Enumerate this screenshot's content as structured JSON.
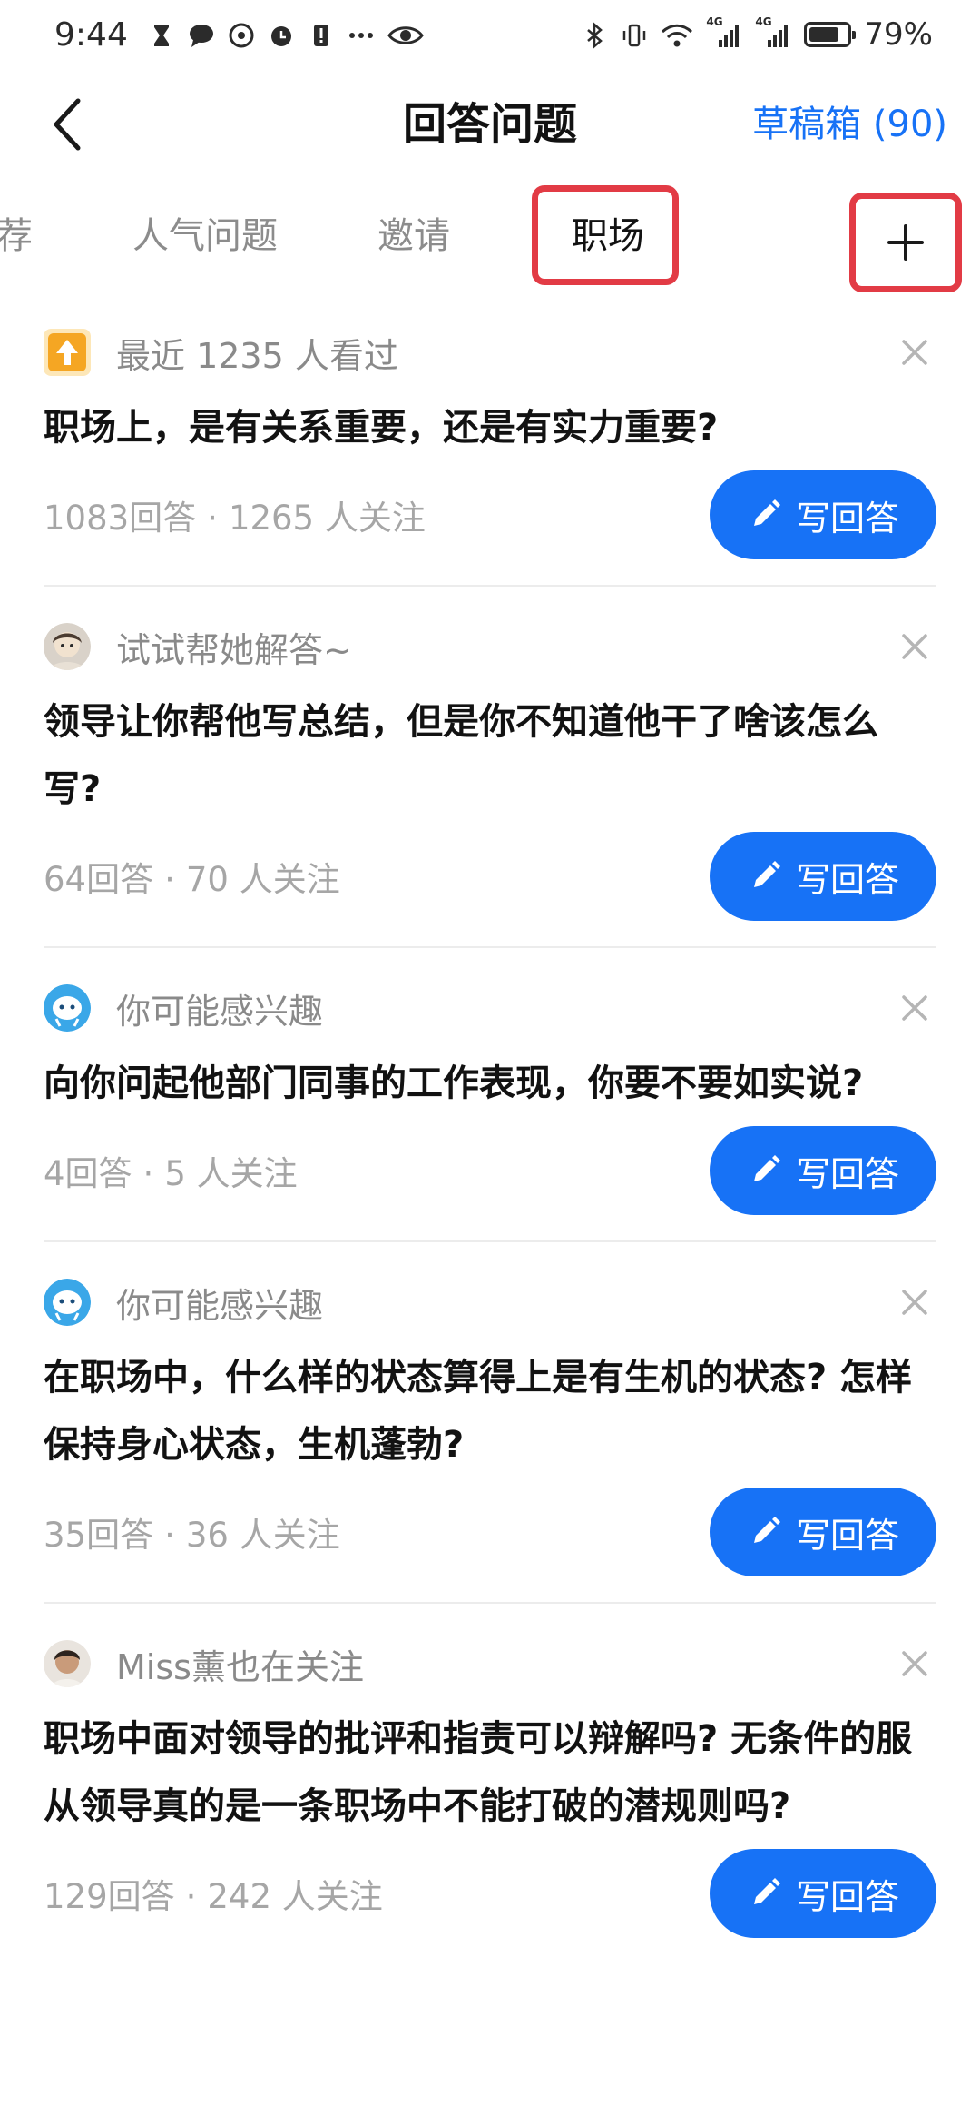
{
  "status_bar": {
    "time": "9:44",
    "battery": "79%",
    "battery_level": 0.79,
    "network_labels": [
      "4G",
      "4G"
    ]
  },
  "header": {
    "back_icon": "chevron-left-icon",
    "title": "回答问题",
    "drafts_label": "草稿箱 (90)"
  },
  "tabs": [
    {
      "label": "荐",
      "active": false
    },
    {
      "label": "人气问题",
      "active": false
    },
    {
      "label": "邀请",
      "active": false
    },
    {
      "label": "职场",
      "active": true
    }
  ],
  "add_tab_icon": "plus-icon",
  "questions": [
    {
      "reason": "最近 1235 人看过",
      "reason_icon": "trending-up-icon",
      "title": "职场上，是有关系重要，还是有实力重要?",
      "answers": "1083回答",
      "separator": "·",
      "followers": "1265 人关注",
      "button_label": "写回答"
    },
    {
      "reason": "试试帮她解答~",
      "reason_icon": "user-avatar",
      "title": "领导让你帮他写总结，但是你不知道他干了啥该怎么写?",
      "answers": "64回答",
      "separator": "·",
      "followers": "70 人关注",
      "button_label": "写回答"
    },
    {
      "reason": "你可能感兴趣",
      "reason_icon": "mascot-avatar",
      "title": "向你问起他部门同事的工作表现，你要不要如实说?",
      "answers": "4回答",
      "separator": "·",
      "followers": "5 人关注",
      "button_label": "写回答"
    },
    {
      "reason": "你可能感兴趣",
      "reason_icon": "mascot-avatar",
      "title": "在职场中，什么样的状态算得上是有生机的状态? 怎样保持身心状态，生机蓬勃?",
      "answers": "35回答",
      "separator": "·",
      "followers": "36 人关注",
      "button_label": "写回答"
    },
    {
      "reason": "Miss薰也在关注",
      "reason_icon": "user-avatar",
      "title": "职场中面对领导的批评和指责可以辩解吗? 无条件的服从领导真的是一条职场中不能打破的潜规则吗?",
      "answers": "129回答",
      "separator": "·",
      "followers": "242 人关注",
      "button_label": "写回答"
    }
  ],
  "colors": {
    "accent": "#1772f6",
    "highlight_border": "#e23b45",
    "muted_text": "#8a8a8a",
    "trending_badge": "#f5a623"
  }
}
